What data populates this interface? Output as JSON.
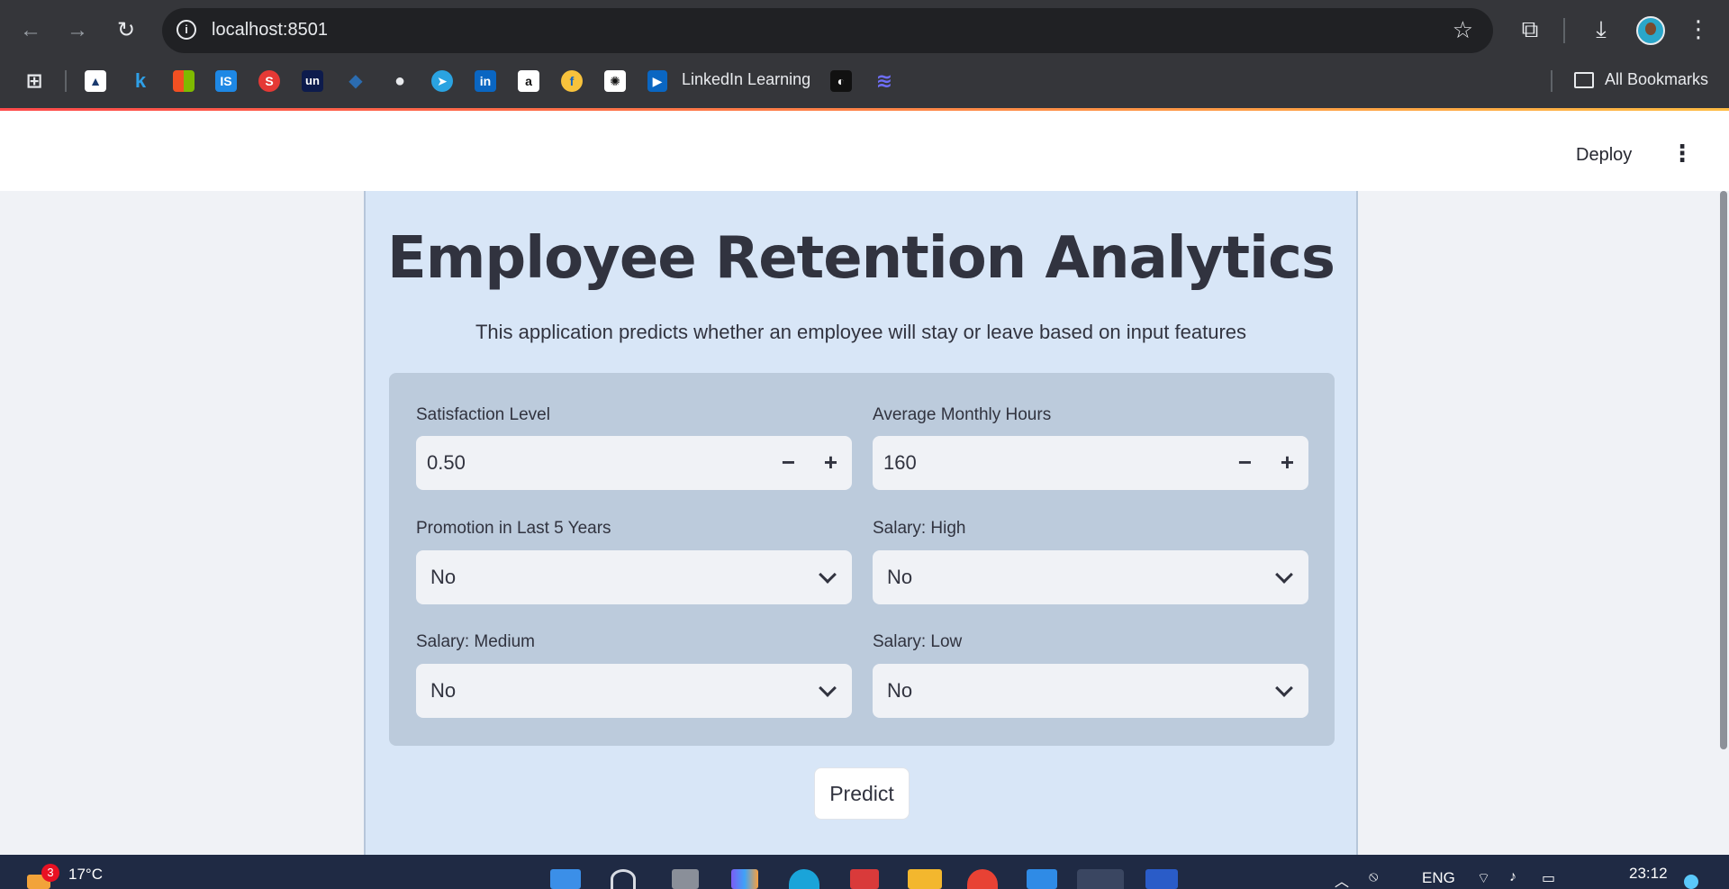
{
  "browser": {
    "url": "localhost:8501",
    "bookmarks_label_linkedin": "LinkedIn Learning",
    "bookmarks_all": "All Bookmarks"
  },
  "header": {
    "deploy_label": "Deploy"
  },
  "app": {
    "title": "Employee Retention Analytics",
    "subtitle": "This application predicts whether an employee will stay or leave based on input features",
    "fields": {
      "satisfaction": {
        "label": "Satisfaction Level",
        "value": "0.50"
      },
      "monthly_hours": {
        "label": "Average Monthly Hours",
        "value": "160"
      },
      "promotion": {
        "label": "Promotion in Last 5 Years",
        "value": "No"
      },
      "salary_high": {
        "label": "Salary: High",
        "value": "No"
      },
      "salary_medium": {
        "label": "Salary: Medium",
        "value": "No"
      },
      "salary_low": {
        "label": "Salary: Low",
        "value": "No"
      }
    },
    "stepper_minus": "−",
    "stepper_plus": "+",
    "predict_label": "Predict"
  },
  "taskbar": {
    "weather_badge": "3",
    "temperature": "17°C",
    "language": "ENG",
    "time": "23:12"
  },
  "colors": {
    "accent_gradient_start": "#ff4b4b",
    "accent_gradient_end": "#ffbd45",
    "main_panel": "#d8e6f7",
    "form_panel": "#bccbdc"
  }
}
